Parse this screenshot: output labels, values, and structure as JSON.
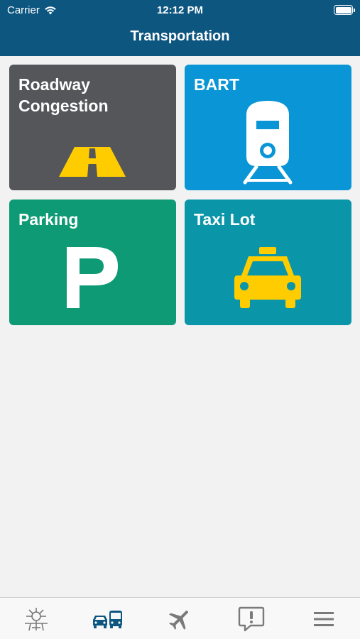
{
  "status_bar": {
    "carrier": "Carrier",
    "time": "12:12 PM"
  },
  "nav": {
    "title": "Transportation"
  },
  "tiles": [
    {
      "label": "Roadway Congestion",
      "color": "#545659",
      "icon": "road-icon"
    },
    {
      "label": "BART",
      "color": "#0a96d6",
      "icon": "train-icon"
    },
    {
      "label": "Parking",
      "color": "#0d9a74",
      "icon": "parking-icon"
    },
    {
      "label": "Taxi Lot",
      "color": "#0a95a8",
      "icon": "taxi-icon"
    }
  ],
  "tabbar": {
    "items": [
      {
        "icon": "airport-logo-icon",
        "selected": false
      },
      {
        "icon": "transportation-icon",
        "selected": true
      },
      {
        "icon": "airplane-icon",
        "selected": false
      },
      {
        "icon": "alert-message-icon",
        "selected": false
      },
      {
        "icon": "menu-icon",
        "selected": false
      }
    ],
    "active_color": "#0d5680",
    "inactive_color": "#7a7a7a"
  },
  "colors": {
    "header": "#0d5680",
    "background": "#f2f2f2",
    "accent_yellow": "#ffcc00"
  }
}
